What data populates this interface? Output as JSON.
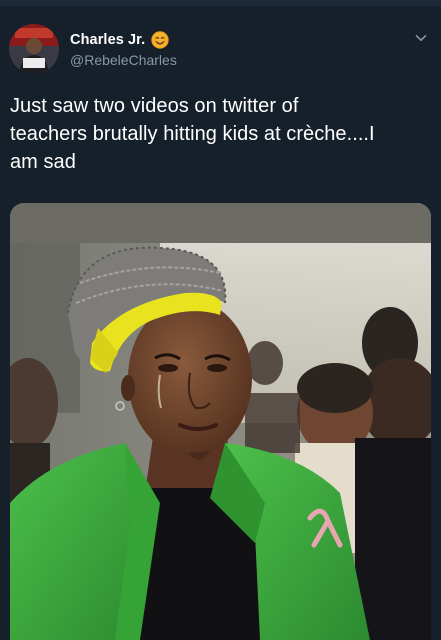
{
  "tweet": {
    "author": {
      "display_name": "Charles Jr.",
      "handle": "@RebeleCharles",
      "name_emoji": "smiling-face-emoji",
      "avatar": "profile-avatar"
    },
    "text": "Just saw two videos on twitter of\nteachers brutally hitting kids at crèche....I\nam sad",
    "menu_icon": "chevron-down-icon",
    "media": {
      "type": "photo",
      "subject": "woman in green blazer and yellow headwrap with a tear on her cheek, pink ribbon pin"
    }
  },
  "colors": {
    "background": "#15202b",
    "text_primary": "#ffffff",
    "text_secondary": "#8899a6",
    "emoji_yellow": "#f6b12e",
    "blazer_green": "#3aa53c",
    "headwrap_yellow": "#e9e21e",
    "ribbon_pink": "#e8a6b0"
  }
}
